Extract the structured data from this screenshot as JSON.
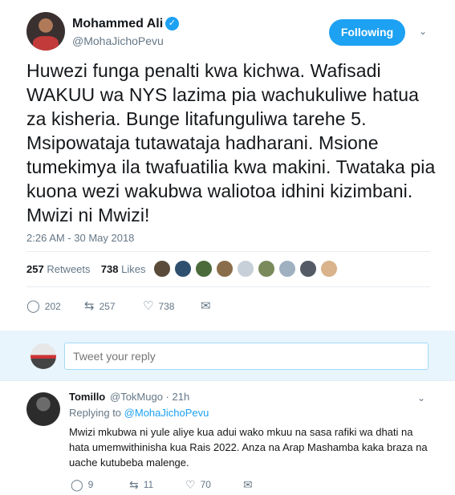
{
  "tweet": {
    "author_name": "Mohammed Ali",
    "author_handle": "@MohaJichoPevu",
    "follow_label": "Following",
    "text": "Huwezi funga penalti kwa kichwa. Wafisadi WAKUU wa NYS lazima pia wachukuliwe hatua za kisheria. Bunge litafunguliwa tarehe 5. Msipowataja tutawataja hadharani. Msione tumekimya ila twafuatilia kwa makini. Twataka pia kuona wezi wakubwa waliotoa idhini kizimbani. Mwizi ni Mwizi!",
    "timestamp": "2:26 AM - 30 May 2018",
    "retweets_count": "257",
    "retweets_label": "Retweets",
    "likes_count": "738",
    "likes_label": "Likes",
    "actions": {
      "reply_count": "202",
      "retweet_count": "257",
      "like_count": "738"
    }
  },
  "likers_colors": [
    "#5a4a3a",
    "#2f4f6f",
    "#4c6b3a",
    "#8a6d4a",
    "#c7d0d8",
    "#7a8a5a",
    "#9fb0c0",
    "#555b66",
    "#d9b38c"
  ],
  "reply_box": {
    "placeholder": "Tweet your reply"
  },
  "reply": {
    "author_name": "Tomillo",
    "meta": "@TokMugo · 21h",
    "replying_prefix": "Replying to",
    "replying_handle": "@MohaJichoPevu",
    "text": "Mwizi mkubwa ni yule aliye kua adui wako mkuu na sasa rafiki wa dhati na hata umemwithinisha kua Rais 2022. Anza na Arap Mashamba kaka braza na uache kutubeba malenge.",
    "reply_count": "9",
    "retweet_count": "11",
    "like_count": "70"
  },
  "colors": {
    "accent": "#1da1f2",
    "text": "#14171a",
    "muted": "#657786",
    "reply_band": "#e8f5fd"
  },
  "icons": {
    "verified": "verified-badge-icon",
    "caret": "chevron-down-icon",
    "reply": "reply-icon",
    "retweet": "retweet-icon",
    "like": "heart-icon",
    "dm": "envelope-icon"
  }
}
